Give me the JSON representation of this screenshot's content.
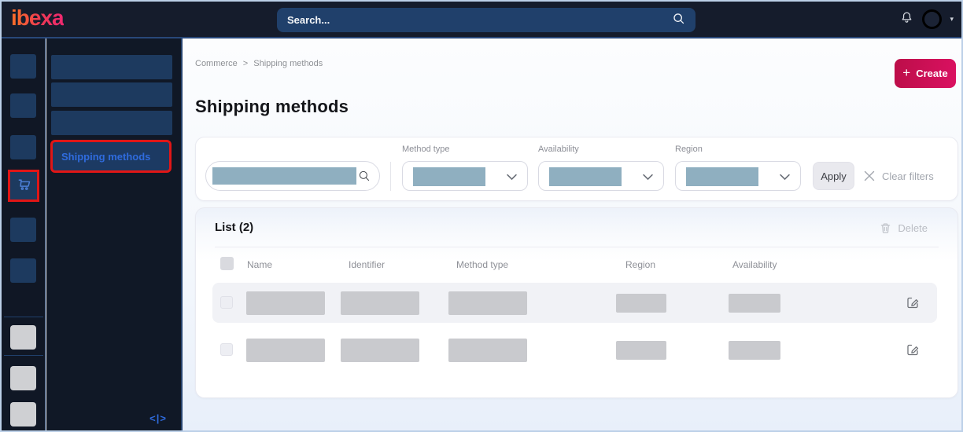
{
  "topbar": {
    "logo": "ibexa",
    "search_placeholder": "Search...",
    "user_caret": "▾"
  },
  "sidebar": {
    "icon_placeholders_above_active": 3,
    "active_icon": "shopping-cart",
    "icon_placeholders_below_active": 2,
    "bottom_icon_placeholders": 3
  },
  "menu": {
    "placeholder_items": 3,
    "active_item": "Shipping methods",
    "collapse_glyph": "<|>"
  },
  "main": {
    "breadcrumb": {
      "items": [
        "Commerce",
        "Shipping methods"
      ],
      "separator": ">"
    },
    "create_button": {
      "plus": "+",
      "label": "Create"
    },
    "page_title": "Shipping methods",
    "filters": {
      "selects": [
        {
          "label": "Method type"
        },
        {
          "label": "Availability"
        },
        {
          "label": "Region"
        }
      ],
      "apply_label": "Apply",
      "clear_filters_label": "Clear filters"
    },
    "list": {
      "title": "List (2)",
      "count": 2,
      "delete_label": "Delete",
      "columns": [
        "Name",
        "Identifier",
        "Method type",
        "Region",
        "Availability"
      ],
      "row_count": 2
    }
  },
  "icons": {
    "global-search": "magnifier",
    "notifications": "bell",
    "user-menu": "avatar-circle + caret",
    "commerce-nav": "shopping-cart",
    "sidebar-collapse": "<|>",
    "create": "plus",
    "filter-search": "magnifier",
    "select": "chevron-down",
    "clear-filters": "x",
    "delete": "trash",
    "row-edit": "edit-pencil"
  },
  "colors": {
    "brand_gradient_start": "#f96a2c",
    "brand_gradient_end": "#ee2a6e",
    "create_gradient_start": "#bc0e49",
    "create_gradient_end": "#da1161",
    "annotation_highlight_red": "#e11616",
    "topbar_bg": "#151c2c",
    "topbar_search_bg": "#20406b",
    "sidebar_bg": "#101725",
    "sidebar_placeholder_blue": "#1d3a5f",
    "active_link_blue": "#2f6bdd",
    "filter_redaction_block": "#8fafc0",
    "table_redaction_block": "#c9cace",
    "row_alt_bg": "#f1f2f6"
  }
}
